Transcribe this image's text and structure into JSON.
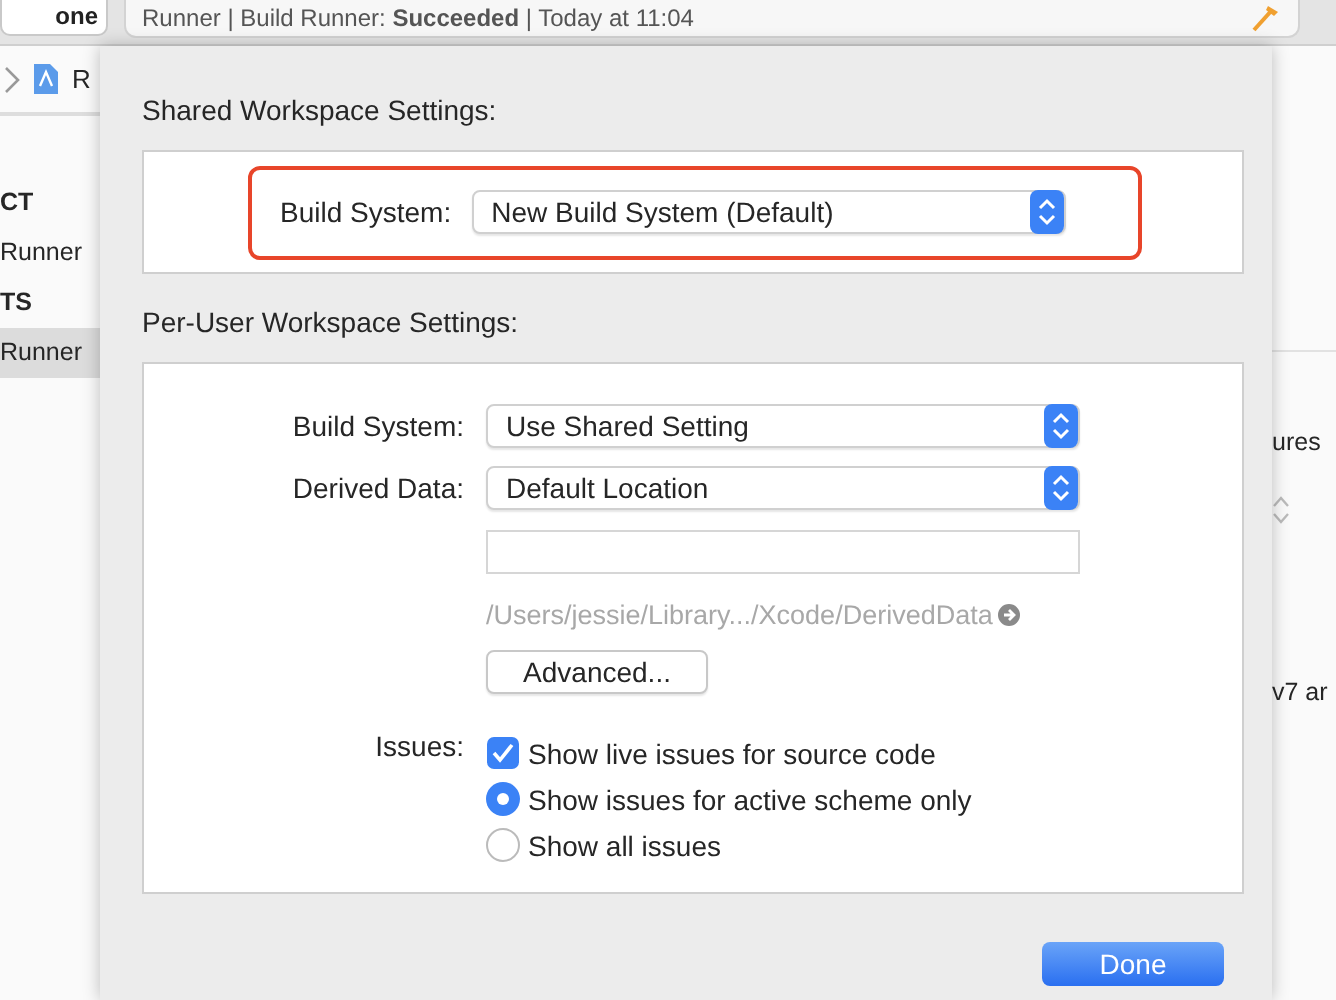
{
  "toolbar": {
    "button": "one",
    "activity": "Runner | Build Runner: **Succeeded** | Today at 11:04"
  },
  "navigator": {
    "jump_bar": "R",
    "items": [
      {
        "kind": "header",
        "label": "CT",
        "selected": false
      },
      {
        "kind": "item",
        "label": "Runner",
        "selected": false
      },
      {
        "kind": "header",
        "label": "TS",
        "selected": false
      },
      {
        "kind": "item",
        "label": "Runner",
        "selected": true
      }
    ]
  },
  "editor_edge": [
    "ures",
    "v7 ar"
  ],
  "sheet": {
    "shared_title": "Shared Workspace Settings:",
    "shared_build_system": {
      "label": "Build System:",
      "value": "New Build System (Default)",
      "highlighted": true
    },
    "per_user_title": "Per-User Workspace Settings:",
    "popups": [
      {
        "label": "Build System:",
        "value": "Use Shared Setting"
      },
      {
        "label": "Derived Data:",
        "value": "Default Location"
      }
    ],
    "path": "/Users/jessie/Library.../Xcode/DerivedData",
    "advanced_button": "Advanced...",
    "issues_label": "Issues:",
    "options": [
      {
        "kind": "checkbox",
        "label": "Show live issues for source code",
        "checked": true
      },
      {
        "kind": "radio",
        "label": "Show issues for active scheme only",
        "selected": true
      },
      {
        "kind": "radio",
        "label": "Show all issues",
        "selected": false
      }
    ],
    "done_button": "Done"
  }
}
